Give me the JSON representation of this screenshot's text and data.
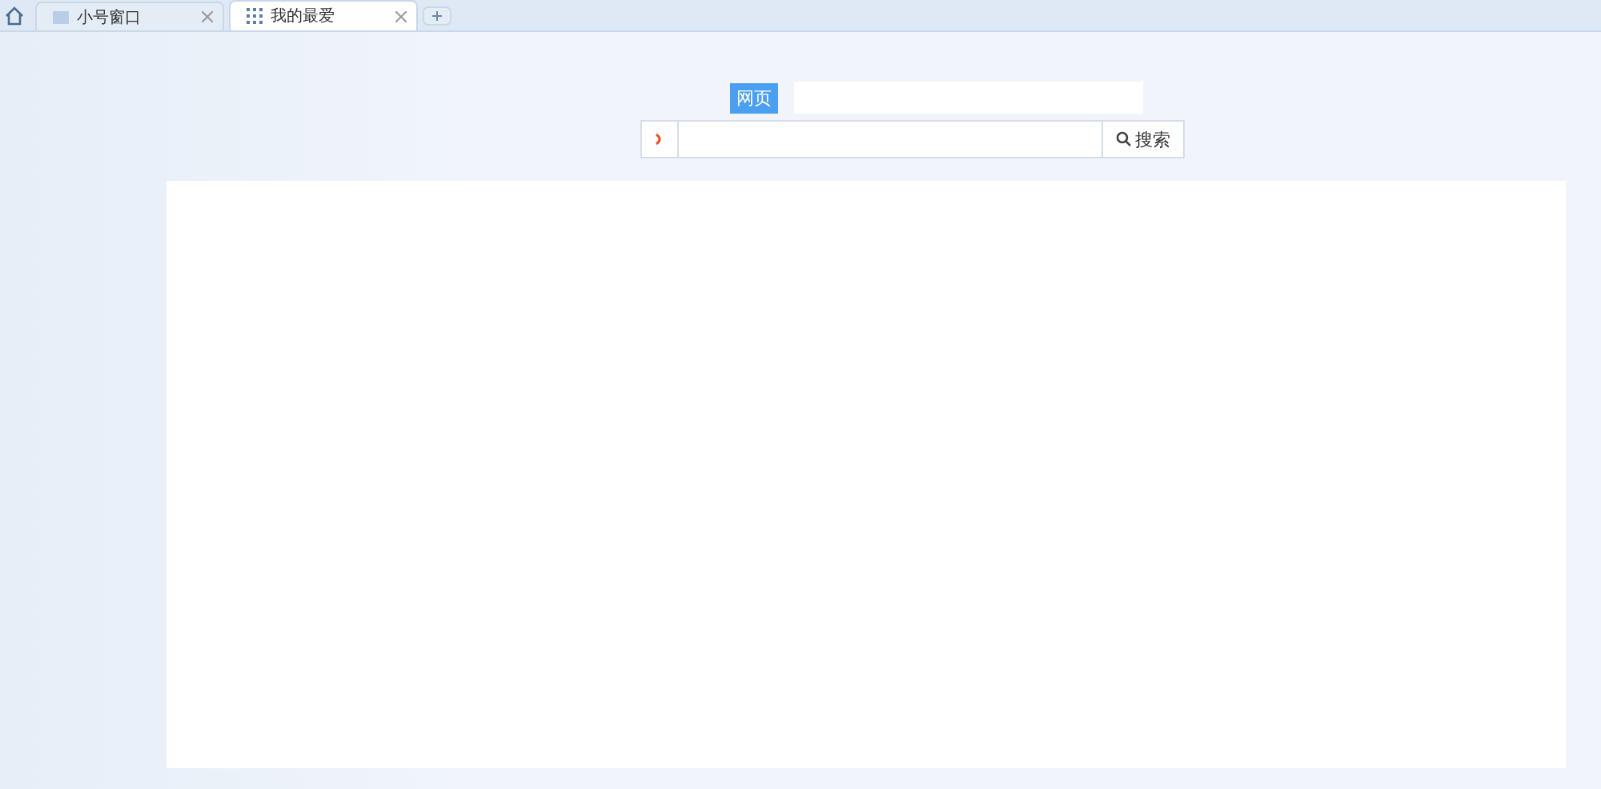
{
  "tabs": [
    {
      "label": "小号窗口",
      "selected": false
    },
    {
      "label": "我的最爱",
      "selected": true
    }
  ],
  "search": {
    "category": "网页",
    "button": "搜索"
  }
}
